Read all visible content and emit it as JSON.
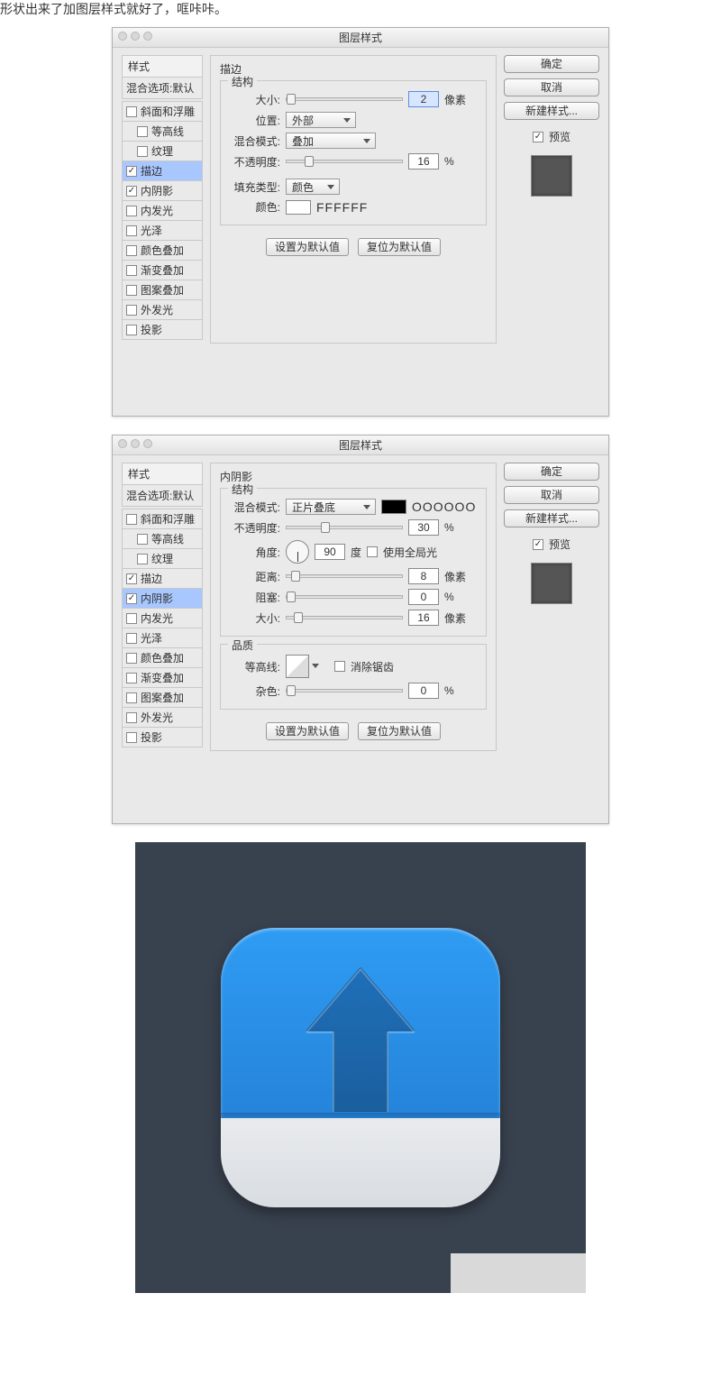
{
  "intro_text": "形状出来了加图层样式就好了，哐咔咔。",
  "dialog_title": "图层样式",
  "left_panel": {
    "header": "样式",
    "blend_options": "混合选项:默认",
    "items": [
      {
        "label": "斜面和浮雕",
        "checked": false,
        "indent": false
      },
      {
        "label": "等高线",
        "checked": false,
        "indent": true
      },
      {
        "label": "纹理",
        "checked": false,
        "indent": true
      },
      {
        "label": "描边",
        "checked": true,
        "indent": false
      },
      {
        "label": "内阴影",
        "checked": true,
        "indent": false
      },
      {
        "label": "内发光",
        "checked": false,
        "indent": false
      },
      {
        "label": "光泽",
        "checked": false,
        "indent": false
      },
      {
        "label": "颜色叠加",
        "checked": false,
        "indent": false
      },
      {
        "label": "渐变叠加",
        "checked": false,
        "indent": false
      },
      {
        "label": "图案叠加",
        "checked": false,
        "indent": false
      },
      {
        "label": "外发光",
        "checked": false,
        "indent": false
      },
      {
        "label": "投影",
        "checked": false,
        "indent": false
      }
    ]
  },
  "right_panel": {
    "ok": "确定",
    "cancel": "取消",
    "new_style": "新建样式...",
    "preview": "预览"
  },
  "buttons": {
    "make_default": "设置为默认值",
    "reset_default": "复位为默认值"
  },
  "labels": {
    "structure": "结构",
    "size": "大小:",
    "position": "位置:",
    "blend_mode": "混合模式:",
    "opacity": "不透明度:",
    "fill_type": "填充类型:",
    "color": "颜色:",
    "angle": "角度:",
    "use_global": "使用全局光",
    "distance": "距离:",
    "choke": "阻塞:",
    "quality": "品质",
    "contour": "等高线:",
    "antialias": "消除锯齿",
    "noise": "杂色:",
    "px": "像素",
    "pct": "%",
    "deg": "度"
  },
  "dialog1": {
    "section": "描边",
    "size": "2",
    "position": "外部",
    "blend_mode": "叠加",
    "opacity": "16",
    "fill_type": "颜色",
    "color_hex": "FFFFFF",
    "selected_index": 3
  },
  "dialog2": {
    "section": "内阴影",
    "blend_mode": "正片叠底",
    "color_hex": "OOOOOO",
    "opacity": "30",
    "angle": "90",
    "use_global": false,
    "distance": "8",
    "choke": "0",
    "size": "16",
    "noise": "0",
    "selected_index": 4
  }
}
